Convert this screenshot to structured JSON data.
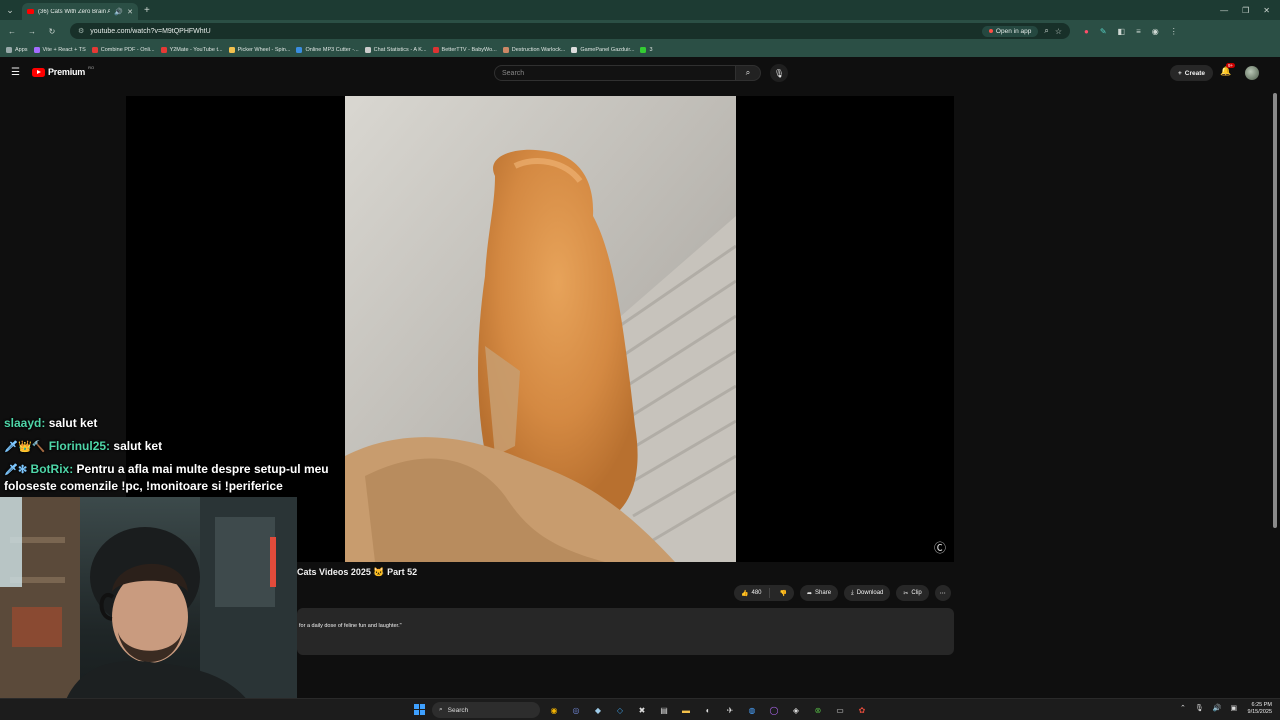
{
  "browser": {
    "tab": {
      "title": "(36) Cats With Zero Brain A..."
    },
    "new_tab_icon": "plus-icon",
    "address": "youtube.com/watch?v=M9tQPHFWhtU",
    "open_in_app": "Open in app",
    "bookmarks": [
      {
        "label": "Apps",
        "color": "#9aa"
      },
      {
        "label": "Vite + React + TS",
        "color": "#a46cff"
      },
      {
        "label": "Combine PDF - Onli...",
        "color": "#e53935"
      },
      {
        "label": "Y2Mate - YouTube t...",
        "color": "#e53935"
      },
      {
        "label": "Picker Wheel - Spin...",
        "color": "#f2c14e"
      },
      {
        "label": "Online MP3 Cutter -...",
        "color": "#3a8de0"
      },
      {
        "label": "Chat Statistics - A K...",
        "color": "#cccccc"
      },
      {
        "label": "BetterTTV - BabyWo...",
        "color": "#d33"
      },
      {
        "label": "Destruction Warlock...",
        "color": "#c86"
      },
      {
        "label": "GamePanel Gazduir...",
        "color": "#ddd"
      },
      {
        "label": "3",
        "color": "#3c3"
      }
    ]
  },
  "youtube": {
    "logo_word": "Premium",
    "country": "RO",
    "search_placeholder": "Search",
    "create_label": "Create",
    "notifications": "9+",
    "video_title": "Cats Videos 2025 🐱 Part 52",
    "likes": "480",
    "share": "Share",
    "download": "Download",
    "clip": "Clip",
    "description": "for a daily dose of feline fun and laughter.\""
  },
  "chat": [
    {
      "badges": "",
      "user": "slaayd:",
      "message": "salut ket"
    },
    {
      "badges": "🗡👑🔨",
      "user": "Florinul25:",
      "message": "salut ket"
    },
    {
      "badges": "🗡✻",
      "user": "BotRix:",
      "message": "Pentru a afla mai multe despre setup-ul meu foloseste comenzile !pc, !monitoare si !periferice"
    }
  ],
  "taskbar": {
    "search_label": "Search",
    "time": "6:25 PM",
    "date": "9/15/2025"
  }
}
